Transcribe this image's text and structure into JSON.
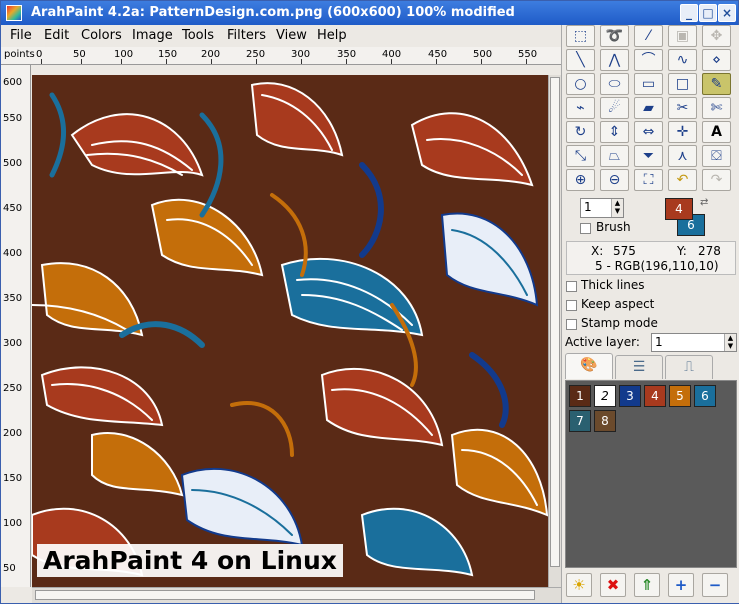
{
  "window": {
    "title": "ArahPaint 4.2a: PatternDesign.com.png  (600x600) 100% modified",
    "minimize": "_",
    "maximize": "□",
    "close": "×"
  },
  "menu": [
    "File",
    "Edit",
    "Colors",
    "Image",
    "Tools",
    "Filters",
    "View",
    "Help"
  ],
  "ruler": {
    "unit": "points",
    "h_labels": [
      "0",
      "50",
      "100",
      "150",
      "200",
      "250",
      "300",
      "350",
      "400",
      "450",
      "500",
      "550"
    ],
    "v_labels": [
      "600",
      "550",
      "500",
      "450",
      "400",
      "350",
      "300",
      "250",
      "200",
      "150",
      "100",
      "50"
    ]
  },
  "overlay_caption": "ArahPaint 4 on Linux",
  "tools": [
    "select-rect-icon",
    "lasso-icon",
    "magic-wand-icon",
    "crop-icon",
    "move-icon",
    "line-icon",
    "polyline-icon",
    "curve-icon",
    "bezier-icon",
    "path-icon",
    "ellipse-outline-icon",
    "ellipse-icon",
    "rectangle-icon",
    "square-icon",
    "pencil-icon",
    "eyedropper-icon",
    "spray-icon",
    "eraser-icon",
    "scissors-icon",
    "cut-color-icon",
    "rotate-icon",
    "flip-vertical-icon",
    "flip-horizontal-icon",
    "align-icon",
    "text-icon",
    "resize-icon",
    "perspective-icon",
    "funnel-icon",
    "compass-icon",
    "bucket-icon",
    "zoom-in-icon",
    "zoom-out-icon",
    "zoom-fit-icon",
    "undo-icon",
    "redo-icon"
  ],
  "brush": {
    "size": "1",
    "label": "Brush",
    "primary_color_index": "4",
    "secondary_color_index": "6",
    "primary_color": "#a83a1e",
    "secondary_color": "#1a6f9c"
  },
  "cursor": {
    "x_label": "X:",
    "x": "575",
    "y_label": "Y:",
    "y": "278",
    "color_info": "5 - RGB(196,110,10)"
  },
  "options": {
    "thick_lines": "Thick lines",
    "keep_aspect": "Keep aspect",
    "stamp_mode": "Stamp mode",
    "active_layer_label": "Active layer:",
    "active_layer_value": "1"
  },
  "palette": [
    {
      "index": "1",
      "color": "#5a2a16"
    },
    {
      "index": "2",
      "color": "#ffffff"
    },
    {
      "index": "3",
      "color": "#123a8c"
    },
    {
      "index": "4",
      "color": "#a83a1e"
    },
    {
      "index": "5",
      "color": "#c46e0a"
    },
    {
      "index": "6",
      "color": "#1a6f9c"
    },
    {
      "index": "7",
      "color": "#2a6070"
    },
    {
      "index": "8",
      "color": "#6b4a2c"
    }
  ],
  "colors": {
    "titlebar": "#2a66d0",
    "canvas_background": "#5a2a16",
    "palette_background": "#5a5a5a"
  }
}
